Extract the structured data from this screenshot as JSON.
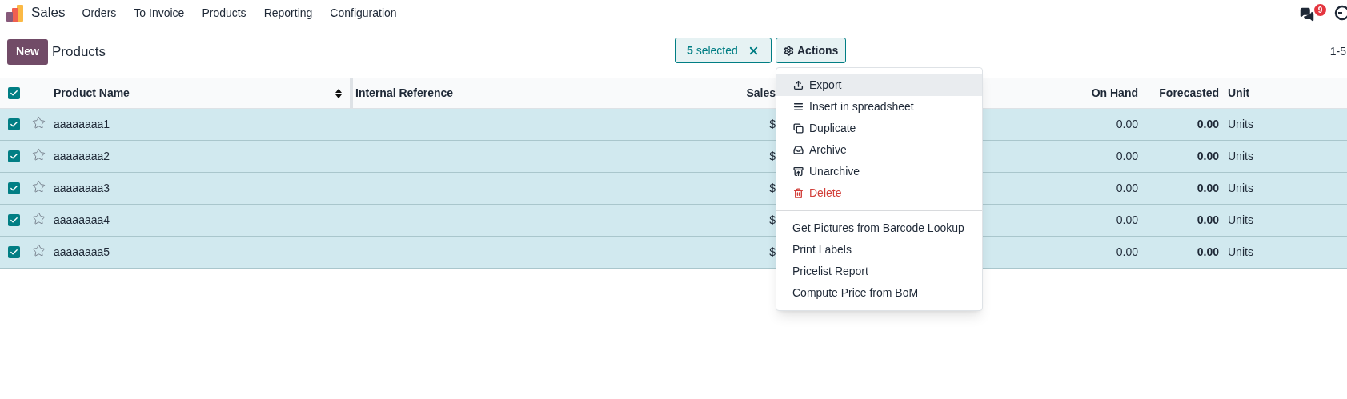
{
  "navbar": {
    "app": "Sales",
    "menu": [
      "Orders",
      "To Invoice",
      "Products",
      "Reporting",
      "Configuration"
    ],
    "chat_badge": "9"
  },
  "control_panel": {
    "new_button": "New",
    "title": "Products",
    "selection": {
      "count": "5",
      "label": "selected"
    },
    "actions_button": "Actions",
    "pager": "1-5"
  },
  "table": {
    "all_checked": true,
    "columns": [
      "Product Name",
      "Internal Reference",
      "Sales",
      "On Hand",
      "Forecasted",
      "Unit"
    ],
    "rows": [
      {
        "checked": true,
        "starred": false,
        "name": "aaaaaaaa1",
        "sales": "$",
        "on_hand": "0.00",
        "forecasted": "0.00",
        "unit": "Units"
      },
      {
        "checked": true,
        "starred": false,
        "name": "aaaaaaaa2",
        "sales": "$",
        "on_hand": "0.00",
        "forecasted": "0.00",
        "unit": "Units"
      },
      {
        "checked": true,
        "starred": false,
        "name": "aaaaaaaa3",
        "sales": "$",
        "on_hand": "0.00",
        "forecasted": "0.00",
        "unit": "Units"
      },
      {
        "checked": true,
        "starred": false,
        "name": "aaaaaaaa4",
        "sales": "$",
        "on_hand": "0.00",
        "forecasted": "0.00",
        "unit": "Units"
      },
      {
        "checked": true,
        "starred": false,
        "name": "aaaaaaaa5",
        "sales": "$",
        "on_hand": "0.00",
        "forecasted": "0.00",
        "unit": "Units"
      }
    ]
  },
  "actions_menu": [
    {
      "kind": "action",
      "label": "Export",
      "highlighted": true
    },
    {
      "kind": "action",
      "label": "Insert in spreadsheet",
      "highlighted": false
    },
    {
      "kind": "action",
      "label": "Duplicate",
      "highlighted": false
    },
    {
      "kind": "action",
      "label": "Archive",
      "highlighted": false
    },
    {
      "kind": "action",
      "label": "Unarchive",
      "highlighted": false
    },
    {
      "kind": "danger",
      "label": "Delete",
      "highlighted": false
    },
    {
      "kind": "plain",
      "label": "Get Pictures from Barcode Lookup",
      "highlighted": false
    },
    {
      "kind": "plain",
      "label": "Print Labels",
      "highlighted": false
    },
    {
      "kind": "plain",
      "label": "Pricelist Report",
      "highlighted": false
    },
    {
      "kind": "plain",
      "label": "Compute Price from BoM",
      "highlighted": false
    }
  ]
}
